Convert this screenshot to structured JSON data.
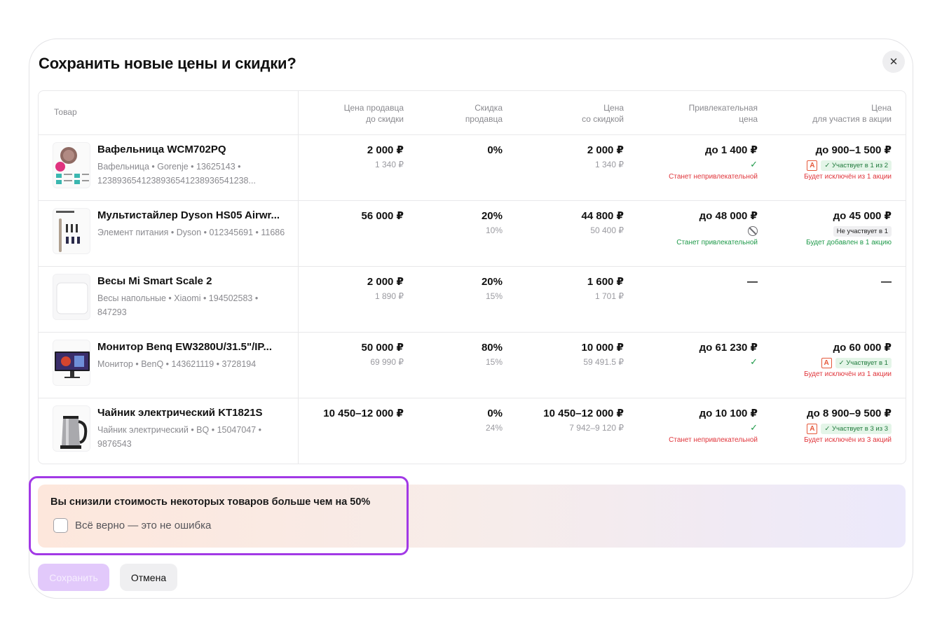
{
  "modal": {
    "title": "Сохранить новые цены и скидки?",
    "close_label": "✕"
  },
  "table": {
    "headers": {
      "product": "Товар",
      "seller_price": [
        "Цена продавца",
        "до скидки"
      ],
      "seller_discount": [
        "Скидка",
        "продавца"
      ],
      "discounted_price": [
        "Цена",
        "со скидкой"
      ],
      "attractive_price": [
        "Привлекательная",
        "цена"
      ],
      "promo_price": [
        "Цена",
        "для участия в акции"
      ]
    },
    "rows": [
      {
        "name": "Вафельница WCM702PQ",
        "meta": "Вафельница • Gorenje • 13625143 • 1238936541238936541238936541238...",
        "image_icon": "waffle-maker-image",
        "seller_price": "2 000 ₽",
        "seller_price_old": "1 340 ₽",
        "discount": "0%",
        "discount_old": "",
        "discounted_price": "2 000 ₽",
        "discounted_price_old": "1 340 ₽",
        "attractive_price": "до 1 400 ₽",
        "attractive_status_icon": "check-icon",
        "attractive_note": "Станет непривлекательной",
        "attractive_note_color": "red",
        "promo_price": "до 900–1 500 ₽",
        "promo_badge_a": "А",
        "promo_pill": "✓ Участвует в 1 из 2",
        "promo_pill_kind": "green",
        "promo_note": "Будет исключён из 1 акции",
        "promo_note_color": "red"
      },
      {
        "name": "Мультистайлер Dyson HS05 Airwr...",
        "meta": "Элемент питания • Dyson • 012345691 • 11686",
        "image_icon": "hair-styler-image",
        "seller_price": "56 000 ₽",
        "seller_price_old": "",
        "discount": "20%",
        "discount_old": "10%",
        "discounted_price": "44 800 ₽",
        "discounted_price_old": "50 400 ₽",
        "attractive_price": "до 48 000 ₽",
        "attractive_status_icon": "ban-icon",
        "attractive_note": "Станет привлекательной",
        "attractive_note_color": "green",
        "promo_price": "до 45 000 ₽",
        "promo_badge_a": "",
        "promo_pill": "Не участвует в 1",
        "promo_pill_kind": "grey",
        "promo_note": "Будет добавлен в 1 акцию",
        "promo_note_color": "green"
      },
      {
        "name": "Весы Mi Smart Scale 2",
        "meta": "Весы напольные • Xiaomi • 194502583 • 847293",
        "image_icon": "scale-image",
        "seller_price": "2 000 ₽",
        "seller_price_old": "1 890 ₽",
        "discount": "20%",
        "discount_old": "15%",
        "discounted_price": "1 600 ₽",
        "discounted_price_old": "1 701 ₽",
        "attractive_price": "—",
        "attractive_status_icon": "",
        "attractive_note": "",
        "attractive_note_color": "",
        "promo_price": "—",
        "promo_badge_a": "",
        "promo_pill": "",
        "promo_pill_kind": "",
        "promo_note": "",
        "promo_note_color": ""
      },
      {
        "name": "Монитор Benq EW3280U/31.5\"/IP...",
        "meta": "Монитор • BenQ • 143621119 • 3728194",
        "image_icon": "monitor-image",
        "seller_price": "50 000 ₽",
        "seller_price_old": "69 990 ₽",
        "discount": "80%",
        "discount_old": "15%",
        "discounted_price": "10 000 ₽",
        "discounted_price_old": "59 491.5 ₽",
        "attractive_price": "до 61 230 ₽",
        "attractive_status_icon": "check-icon",
        "attractive_note": "",
        "attractive_note_color": "",
        "promo_price": "до 60 000 ₽",
        "promo_badge_a": "А",
        "promo_pill": "✓ Участвует в 1",
        "promo_pill_kind": "green",
        "promo_note": "Будет исключён из 1 акции",
        "promo_note_color": "red"
      },
      {
        "name": "Чайник электрический KT1821S",
        "meta": "Чайник электрический • BQ • 15047047 • 9876543",
        "image_icon": "kettle-image",
        "seller_price": "10 450–12 000 ₽",
        "seller_price_old": "",
        "discount": "0%",
        "discount_old": "24%",
        "discounted_price": "10 450–12 000 ₽",
        "discounted_price_old": "7 942–9 120 ₽",
        "attractive_price": "до 10 100 ₽",
        "attractive_status_icon": "check-icon",
        "attractive_note": "Станет непривлекательной",
        "attractive_note_color": "red",
        "promo_price": "до 8 900–9 500 ₽",
        "promo_badge_a": "А",
        "promo_pill": "✓ Участвует в 3 из 3",
        "promo_pill_kind": "green",
        "promo_note": "Будет исключён из 3 акций",
        "promo_note_color": "red"
      }
    ]
  },
  "warning": {
    "text": "Вы снизили стоимость некоторых товаров больше чем на 50%",
    "checkbox_label": "Всё верно — это не ошибка"
  },
  "actions": {
    "save_label": "Сохранить",
    "cancel_label": "Отмена"
  }
}
